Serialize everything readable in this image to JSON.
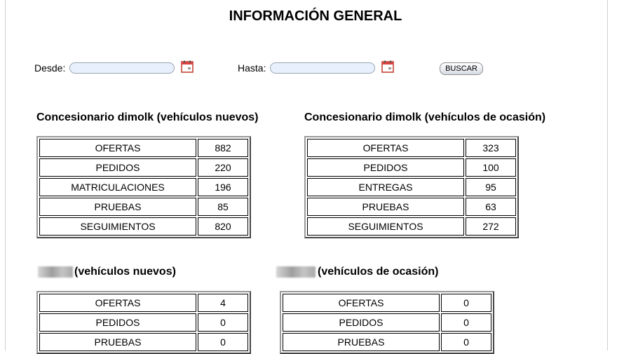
{
  "page": {
    "title": "INFORMACIÓN GENERAL"
  },
  "filters": {
    "from_label": "Desde:",
    "from_value": "",
    "to_label": "Hasta:",
    "to_value": "",
    "search_label": "BUSCAR",
    "calendar_icon": "calendar-icon"
  },
  "sections": [
    {
      "title": "Concesionario dimolk (vehículos nuevos)",
      "rows": [
        {
          "label": "OFERTAS",
          "value": "882"
        },
        {
          "label": "PEDIDOS",
          "value": "220"
        },
        {
          "label": "MATRICULACIONES",
          "value": "196"
        },
        {
          "label": "PRUEBAS",
          "value": "85"
        },
        {
          "label": "SEGUIMIENTOS",
          "value": "820"
        }
      ]
    },
    {
      "title": "Concesionario dimolk (vehículos de ocasión)",
      "rows": [
        {
          "label": "OFERTAS",
          "value": "323"
        },
        {
          "label": "PEDIDOS",
          "value": "100"
        },
        {
          "label": "ENTREGAS",
          "value": "95"
        },
        {
          "label": "PRUEBAS",
          "value": "63"
        },
        {
          "label": "SEGUIMIENTOS",
          "value": "272"
        }
      ]
    },
    {
      "title": "(vehículos nuevos)",
      "rows": [
        {
          "label": "OFERTAS",
          "value": "4"
        },
        {
          "label": "PEDIDOS",
          "value": "0"
        },
        {
          "label": "PRUEBAS",
          "value": "0"
        }
      ]
    },
    {
      "title": "(vehículos de ocasión)",
      "rows": [
        {
          "label": "OFERTAS",
          "value": "0"
        },
        {
          "label": "PEDIDOS",
          "value": "0"
        },
        {
          "label": "PRUEBAS",
          "value": "0"
        }
      ]
    }
  ]
}
